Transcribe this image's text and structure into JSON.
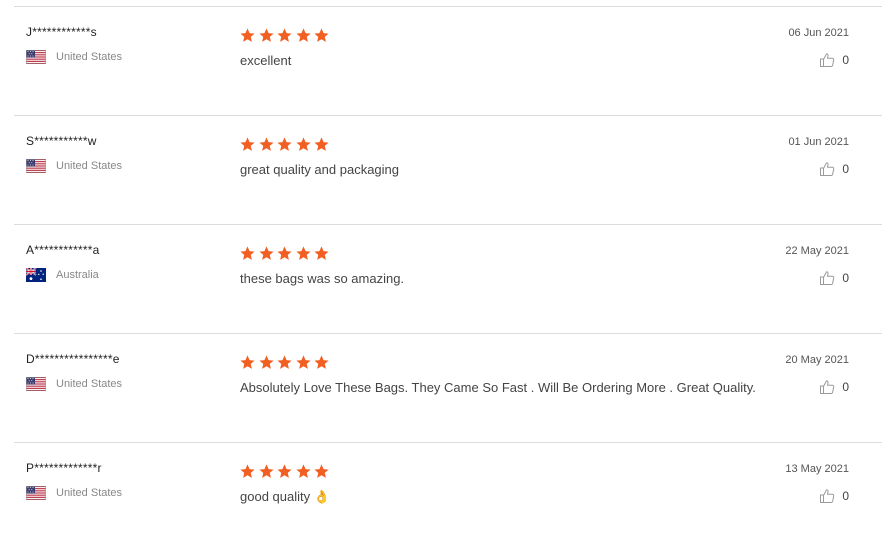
{
  "colors": {
    "star": "#f15f22",
    "divider": "#dcdcdc",
    "country_text": "#888888",
    "body_text": "#444444"
  },
  "reviews": [
    {
      "user": "J************s",
      "country": "United States",
      "flag_icon": "us-flag-icon",
      "rating": 5,
      "text": "excellent",
      "date": "06 Jun 2021",
      "helpful_count": "0"
    },
    {
      "user": "S***********w",
      "country": "United States",
      "flag_icon": "us-flag-icon",
      "rating": 5,
      "text": "great quality and packaging",
      "date": "01 Jun 2021",
      "helpful_count": "0"
    },
    {
      "user": "A************a",
      "country": "Australia",
      "flag_icon": "au-flag-icon",
      "rating": 5,
      "text": "these bags was so amazing.",
      "date": "22 May 2021",
      "helpful_count": "0"
    },
    {
      "user": "D****************e",
      "country": "United States",
      "flag_icon": "us-flag-icon",
      "rating": 5,
      "text": "Absolutely Love These Bags. They Came So Fast . Will Be Ordering More . Great Quality.",
      "date": "20 May 2021",
      "helpful_count": "0"
    },
    {
      "user": "P*************r",
      "country": "United States",
      "flag_icon": "us-flag-icon",
      "rating": 5,
      "text": "good quality 👌",
      "date": "13 May 2021",
      "helpful_count": "0"
    }
  ]
}
